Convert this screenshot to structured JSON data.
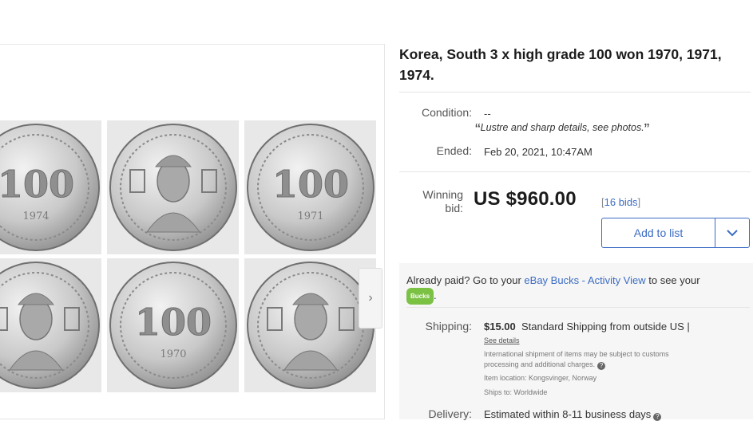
{
  "listing": {
    "title": "Korea, South 3 x high grade 100 won 1970, 1971, 1974.",
    "condition_label": "Condition:",
    "condition_value": "--",
    "condition_quote": "Lustre and sharp details, see photos.",
    "ended_label": "Ended:",
    "ended_value": "Feb 20, 2021, 10:47AM",
    "winning_label_1": "Winning",
    "winning_label_2": "bid:",
    "price": "US $960.00",
    "bids": "16 bids",
    "add_to_list": "Add to list"
  },
  "paid": {
    "prefix": "Already paid? Go to your ",
    "link": "eBay Bucks - Activity View",
    "suffix": " to see your",
    "badge": "Bucks",
    "end": "."
  },
  "shipping": {
    "label": "Shipping:",
    "price": "$15.00",
    "method": "Standard Shipping from outside US |",
    "see_details": "See details",
    "note_line1": "International shipment of items may be subject to customs",
    "note_line2": "processing and additional charges.",
    "location": "Item location:  Kongsvinger, Norway",
    "ships_to": "Ships to:  Worldwide"
  },
  "delivery": {
    "label": "Delivery:",
    "value": "Estimated within 8-11 business days"
  },
  "coins": [
    {
      "face": "100",
      "year": "1974"
    },
    {
      "face": "portrait"
    },
    {
      "face": "100",
      "year": "1971"
    },
    {
      "face": "portrait"
    },
    {
      "face": "100",
      "year": "1970"
    },
    {
      "face": "portrait"
    }
  ],
  "colors": {
    "link": "#3b6cc4",
    "bucks_badge": "#7bc143",
    "coin_silver": "#c9c9c9"
  }
}
